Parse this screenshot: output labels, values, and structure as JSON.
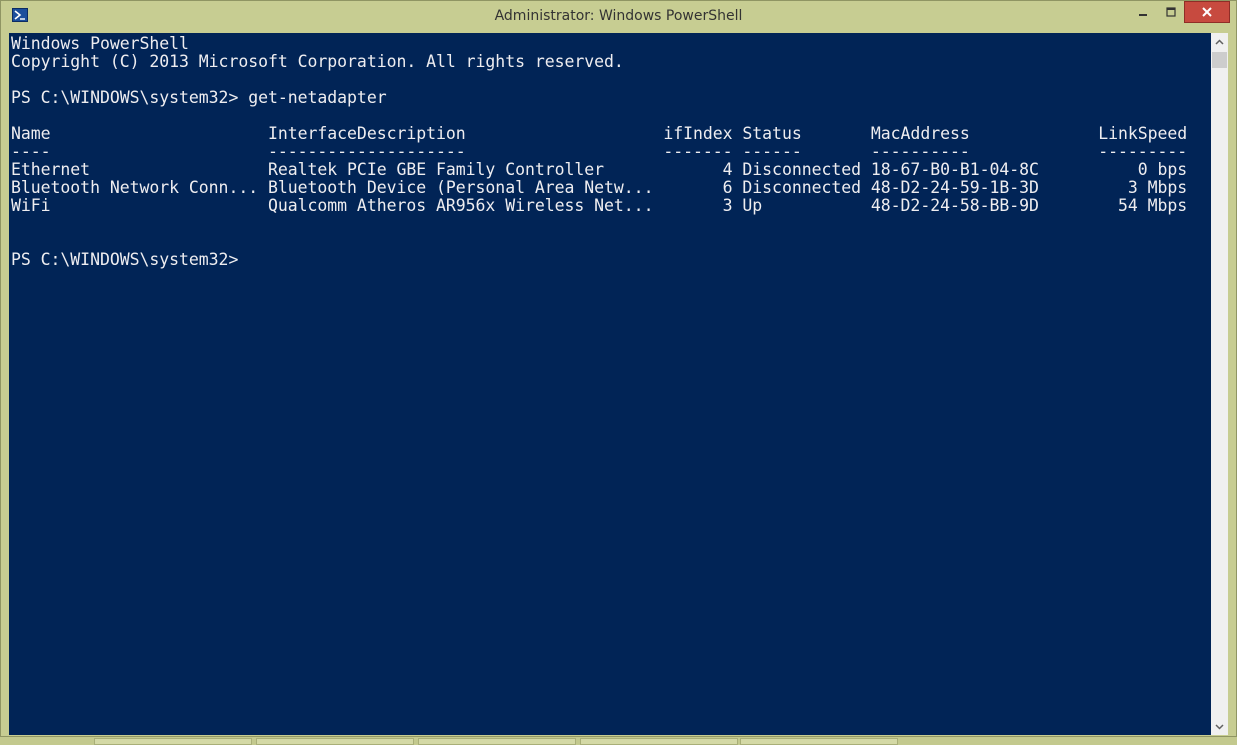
{
  "window": {
    "title": "Administrator: Windows PowerShell",
    "icon": "powershell-icon",
    "controls": [
      "minimize-icon",
      "maximize-icon",
      "close-icon"
    ]
  },
  "console": {
    "banner_line1": "Windows PowerShell",
    "banner_line2": "Copyright (C) 2013 Microsoft Corporation. All rights reserved.",
    "prompt1": "PS C:\\WINDOWS\\system32> get-netadapter",
    "table": {
      "header": "Name                      InterfaceDescription                    ifIndex Status       MacAddress             LinkSpeed",
      "separator": "----                      --------------------                    ------- ------       ----------             ---------",
      "rows": [
        "Ethernet                  Realtek PCIe GBE Family Controller            4 Disconnected 18-67-B0-B1-04-8C          0 bps",
        "Bluetooth Network Conn... Bluetooth Device (Personal Area Netw...       6 Disconnected 48-D2-24-59-1B-3D         3 Mbps",
        "WiFi                      Qualcomm Atheros AR956x Wireless Net...       3 Up           48-D2-24-58-BB-9D        54 Mbps"
      ]
    },
    "prompt2": "PS C:\\WINDOWS\\system32>"
  },
  "colors": {
    "console_bg": "#012456",
    "console_fg": "#eeedf0",
    "frame": "#c7cd92",
    "close_button": "#c74a3f"
  }
}
